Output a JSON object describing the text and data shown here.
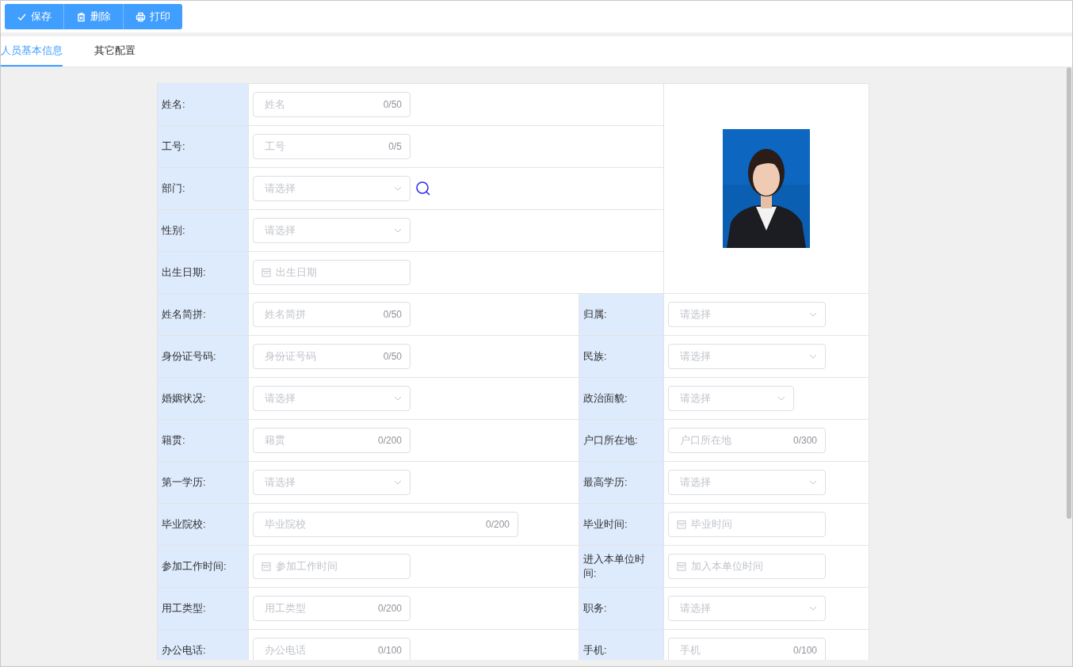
{
  "toolbar": {
    "buttons": [
      {
        "label": "保存",
        "kind": "check"
      },
      {
        "label": "删除",
        "kind": "trash"
      },
      {
        "label": "打印",
        "kind": "printer"
      }
    ]
  },
  "tabs": [
    {
      "label": "人员基本信息",
      "selected": true
    },
    {
      "label": "其它配置",
      "selected": false
    }
  ],
  "form": {
    "top_rows": [
      {
        "label": "姓名:",
        "field": {
          "kind": "text",
          "placeholder": "姓名",
          "counter": "0/50"
        }
      },
      {
        "label": "工号:",
        "field": {
          "kind": "text",
          "placeholder": "工号",
          "counter": "0/5"
        }
      },
      {
        "label": "部门:",
        "field": {
          "kind": "select",
          "placeholder": "请选择"
        },
        "search_button": true
      },
      {
        "label": "性别:",
        "field": {
          "kind": "select",
          "placeholder": "请选择"
        }
      },
      {
        "label": "出生日期:",
        "field": {
          "kind": "date",
          "placeholder": "出生日期"
        }
      }
    ],
    "rows": [
      {
        "left": {
          "label": "姓名简拼:",
          "field": {
            "kind": "text",
            "placeholder": "姓名简拼",
            "counter": "0/50"
          }
        },
        "right": {
          "label": "归属:",
          "field": {
            "kind": "select",
            "placeholder": "请选择"
          }
        }
      },
      {
        "left": {
          "label": "身份证号码:",
          "field": {
            "kind": "text",
            "placeholder": "身份证号码",
            "counter": "0/50"
          }
        },
        "right": {
          "label": "民族:",
          "field": {
            "kind": "select",
            "placeholder": "请选择"
          }
        }
      },
      {
        "left": {
          "label": "婚姻状况:",
          "field": {
            "kind": "select",
            "placeholder": "请选择"
          }
        },
        "right": {
          "label": "政治面貌:",
          "field": {
            "kind": "shortselect",
            "placeholder": "请选择"
          }
        }
      },
      {
        "left": {
          "label": "籍贯:",
          "field": {
            "kind": "text",
            "placeholder": "籍贯",
            "counter": "0/200"
          }
        },
        "right": {
          "label": "户口所在地:",
          "field": {
            "kind": "text",
            "placeholder": "户口所在地",
            "counter": "0/300"
          }
        }
      },
      {
        "left": {
          "label": "第一学历:",
          "field": {
            "kind": "select",
            "placeholder": "请选择"
          }
        },
        "right": {
          "label": "最高学历:",
          "field": {
            "kind": "select",
            "placeholder": "请选择"
          }
        }
      },
      {
        "left": {
          "label": "毕业院校:",
          "field": {
            "kind": "longtext",
            "placeholder": "毕业院校",
            "counter": "0/200"
          }
        },
        "right": {
          "label": "毕业时间:",
          "field": {
            "kind": "date",
            "placeholder": "毕业时间"
          }
        }
      },
      {
        "left": {
          "label": "参加工作时间:",
          "field": {
            "kind": "date",
            "placeholder": "参加工作时间"
          }
        },
        "right": {
          "label": "进入本单位时间:",
          "field": {
            "kind": "date",
            "placeholder": "加入本单位时间"
          }
        }
      },
      {
        "left": {
          "label": "用工类型:",
          "field": {
            "kind": "text",
            "placeholder": "用工类型",
            "counter": "0/200"
          }
        },
        "right": {
          "label": "职务:",
          "field": {
            "kind": "select",
            "placeholder": "请选择"
          }
        }
      },
      {
        "left": {
          "label": "办公电话:",
          "field": {
            "kind": "text",
            "placeholder": "办公电话",
            "counter": "0/100"
          }
        },
        "right": {
          "label": "手机:",
          "field": {
            "kind": "text",
            "placeholder": "手机",
            "counter": "0/100"
          }
        }
      }
    ]
  }
}
